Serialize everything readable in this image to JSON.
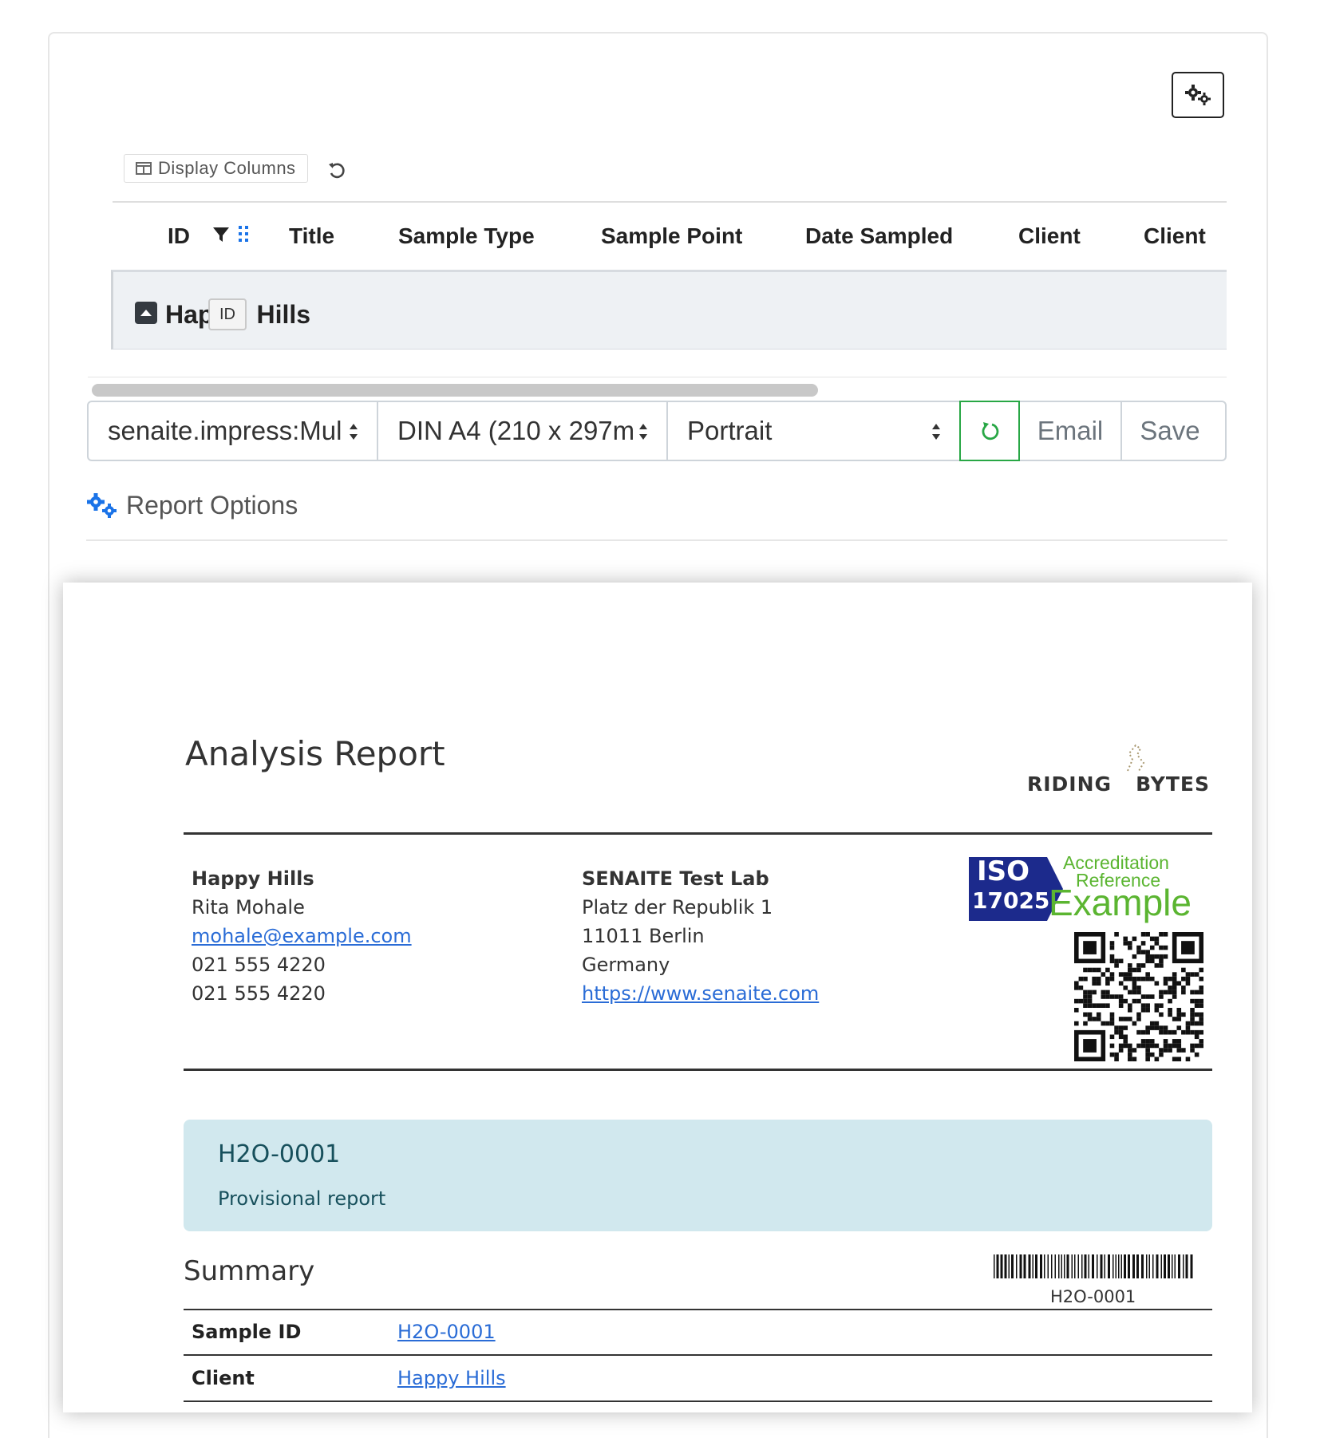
{
  "listing": {
    "settings_icon": "gear-icon",
    "display_columns_label": "Display Columns",
    "columns": [
      "ID",
      "Title",
      "Sample Type",
      "Sample Point",
      "Date Sampled",
      "Client",
      "Client"
    ],
    "group": {
      "title_start": "Hap",
      "title_end": "Hills",
      "tooltip": "ID"
    }
  },
  "toolbar": {
    "template_value": "senaite.impress:Mul",
    "paper_value": "DIN A4 (210 x 297m",
    "orientation_value": "Portrait",
    "email_label": "Email",
    "save_label": "Save"
  },
  "report_options_label": "Report Options",
  "report": {
    "title": "Analysis Report",
    "logo_text_left": "RIDING",
    "logo_text_right": "BYTES",
    "client": {
      "name": "Happy Hills",
      "contact": "Rita Mohale",
      "email": "mohale@example.com",
      "phone": "021 555 4220",
      "fax": "021 555 4220"
    },
    "lab": {
      "name": "SENAITE Test Lab",
      "street": "Platz der Republik 1",
      "city": "11011 Berlin",
      "country": "Germany",
      "url": "https://www.senaite.com"
    },
    "accreditation": {
      "iso_line1": "ISO",
      "iso_line2": "17025",
      "text_line1": "Accreditation",
      "text_line2": "Reference",
      "text_line3": "Example"
    },
    "sample_id": "H2O-0001",
    "status": "Provisional report",
    "summary_heading": "Summary",
    "barcode_label": "H2O-0001",
    "rows": [
      {
        "key": "Sample ID",
        "value": "H2O-0001"
      },
      {
        "key": "Client",
        "value": "Happy Hills"
      }
    ]
  },
  "colors": {
    "accent_blue": "#1a73e8",
    "success_green": "#28a745",
    "alert_bg": "#d1e8ee",
    "iso_navy": "#1c2a8c",
    "iso_green": "#5bb531"
  }
}
